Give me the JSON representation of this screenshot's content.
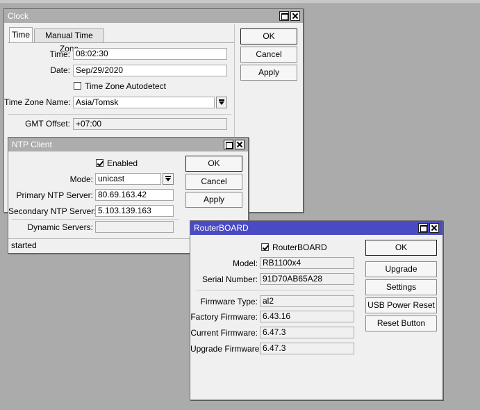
{
  "clock": {
    "title": "Clock",
    "tabs": [
      "Time",
      "Manual Time Zone"
    ],
    "time_label": "Time:",
    "time_value": "08:02:30",
    "date_label": "Date:",
    "date_value": "Sep/29/2020",
    "autodetect_label": "Time Zone Autodetect",
    "autodetect_checked": false,
    "tz_label": "Time Zone Name:",
    "tz_value": "Asia/Tomsk",
    "gmt_label": "GMT Offset:",
    "gmt_value": "+07:00",
    "buttons": [
      "OK",
      "Cancel",
      "Apply"
    ]
  },
  "ntp": {
    "title": "NTP Client",
    "enabled_label": "Enabled",
    "enabled_checked": true,
    "mode_label": "Mode:",
    "mode_value": "unicast",
    "primary_label": "Primary NTP Server:",
    "primary_value": "80.69.163.42",
    "secondary_label": "Secondary NTP Server:",
    "secondary_value": "5.103.139.163",
    "dynamic_label": "Dynamic Servers:",
    "dynamic_value": "",
    "status": "started",
    "buttons": [
      "OK",
      "Cancel",
      "Apply"
    ]
  },
  "rb": {
    "title": "RouterBOARD",
    "rb_label": "RouterBOARD",
    "rb_checked": true,
    "model_label": "Model:",
    "model_value": "RB1100x4",
    "serial_label": "Serial Number:",
    "serial_value": "91D70AB65A28",
    "fwtype_label": "Firmware Type:",
    "fwtype_value": "al2",
    "factory_label": "Factory Firmware:",
    "factory_value": "6.43.16",
    "current_label": "Current Firmware:",
    "current_value": "6.47.3",
    "upgrade_label": "Upgrade Firmware:",
    "upgrade_value": "6.47.3",
    "buttons": [
      "OK",
      "Upgrade",
      "Settings",
      "USB Power Reset",
      "Reset Button"
    ]
  },
  "colors": {
    "active_title": "#4a4ac4",
    "inactive_title": "#adadad",
    "desktop": "#ababab"
  }
}
